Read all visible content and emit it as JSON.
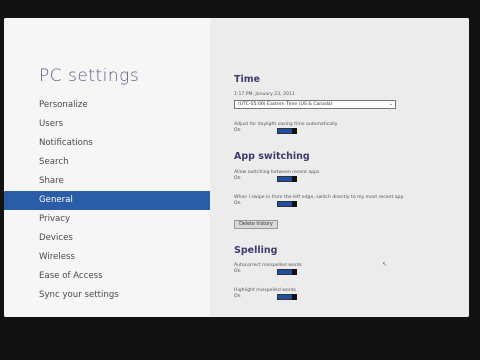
{
  "app": {
    "title": "PC settings"
  },
  "sidebar": {
    "items": [
      {
        "label": "Personalize"
      },
      {
        "label": "Users"
      },
      {
        "label": "Notifications"
      },
      {
        "label": "Search"
      },
      {
        "label": "Share"
      },
      {
        "label": "General",
        "active": true
      },
      {
        "label": "Privacy"
      },
      {
        "label": "Devices"
      },
      {
        "label": "Wireless"
      },
      {
        "label": "Ease of Access"
      },
      {
        "label": "Sync your settings"
      }
    ]
  },
  "time": {
    "heading": "Time",
    "datetime": "1:17 PM, January 23, 2011",
    "timezone": "(UTC-05:00) Eastern Time (US & Canada)",
    "dst_label": "Adjust for daylight saving time automatically",
    "dst_state": "On"
  },
  "app_switching": {
    "heading": "App switching",
    "allow_label": "Allow switching between recent apps",
    "allow_state": "On",
    "swipe_label": "When I swipe in from the left edge, switch directly to my most recent app",
    "swipe_state": "On",
    "delete_button": "Delete history"
  },
  "spelling": {
    "heading": "Spelling",
    "autocorrect_label": "Autocorrect misspelled words",
    "autocorrect_state": "On",
    "highlight_label": "Highlight misspelled words",
    "highlight_state": "On"
  },
  "colors": {
    "accent": "#2b5ca8",
    "title": "#5b5b86"
  },
  "icons": {
    "dropdown": "chevron-down-icon",
    "pointer": "mouse-pointer-icon"
  }
}
